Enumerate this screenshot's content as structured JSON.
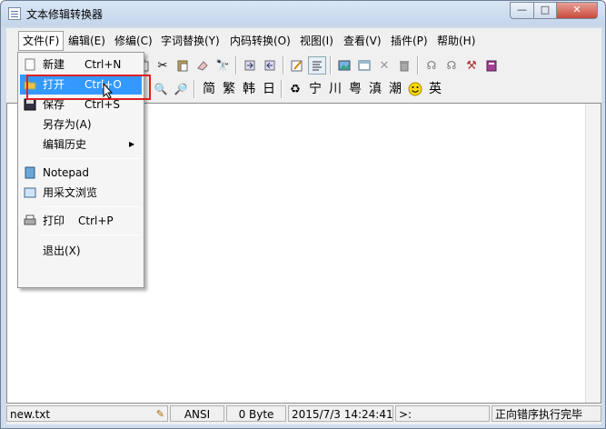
{
  "window": {
    "title": "文本修辑转换器",
    "min_glyph": "—",
    "max_glyph": "□",
    "close_glyph": "✕"
  },
  "menu": [
    "文件(F)",
    "编辑(E)",
    "修编(C)",
    "字词替换(Y)",
    "内码转换(O)",
    "视图(I)",
    "查看(V)",
    "插件(P)",
    "帮助(H)"
  ],
  "toolbar2_chars": [
    "简",
    "繁",
    "韩",
    "日",
    "宁",
    "川",
    "粤",
    "滇",
    "潮",
    "英"
  ],
  "file_menu": {
    "new": {
      "label": "新建",
      "shortcut": "Ctrl+N"
    },
    "open": {
      "label": "打开",
      "shortcut": "Ctrl+O"
    },
    "save": {
      "label": "保存",
      "shortcut": "Ctrl+S"
    },
    "save_as": {
      "label": "另存为(A)"
    },
    "edit_history": {
      "label": "编辑历史",
      "arrow": "▶"
    },
    "notepad": {
      "label": "Notepad"
    },
    "browse": {
      "label": "用采文浏览"
    },
    "print": {
      "label": "打印",
      "shortcut": "Ctrl+P"
    },
    "exit": {
      "label": "退出(X)"
    }
  },
  "status": {
    "filename": "new.txt",
    "encoding": "ANSI",
    "size": "0 Byte",
    "datetime": "2015/7/3 14:24:41",
    "prompt": ">:",
    "message": "正向错序执行完毕"
  }
}
